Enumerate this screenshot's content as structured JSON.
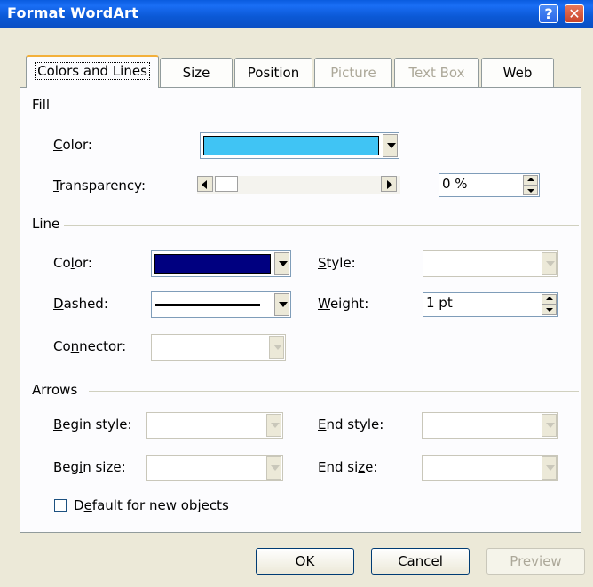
{
  "window": {
    "title": "Format WordArt",
    "help_label": "?",
    "close_label": "✕"
  },
  "tabs": [
    {
      "label": "Colors and Lines",
      "state": "active"
    },
    {
      "label": "Size",
      "state": "enabled"
    },
    {
      "label": "Position",
      "state": "enabled"
    },
    {
      "label": "Picture",
      "state": "disabled"
    },
    {
      "label": "Text Box",
      "state": "disabled"
    },
    {
      "label": "Web",
      "state": "enabled"
    }
  ],
  "fill": {
    "heading": "Fill",
    "color_label": "Color:",
    "color_value": "#40c4f4",
    "transparency_label": "Transparency:",
    "transparency_value": "0 %",
    "transparency_level": 0
  },
  "line": {
    "heading": "Line",
    "color_label": "Color:",
    "color_value": "#000080",
    "style_label": "Style:",
    "dashed_label": "Dashed:",
    "weight_label": "Weight:",
    "weight_value": "1 pt",
    "connector_label": "Connector:"
  },
  "arrows": {
    "heading": "Arrows",
    "begin_style_label": "Begin style:",
    "end_style_label": "End style:",
    "begin_size_label": "Begin size:",
    "end_size_label": "End size:"
  },
  "default_checkbox_label": "Default for new objects",
  "buttons": {
    "ok": "OK",
    "cancel": "Cancel",
    "preview": "Preview"
  }
}
